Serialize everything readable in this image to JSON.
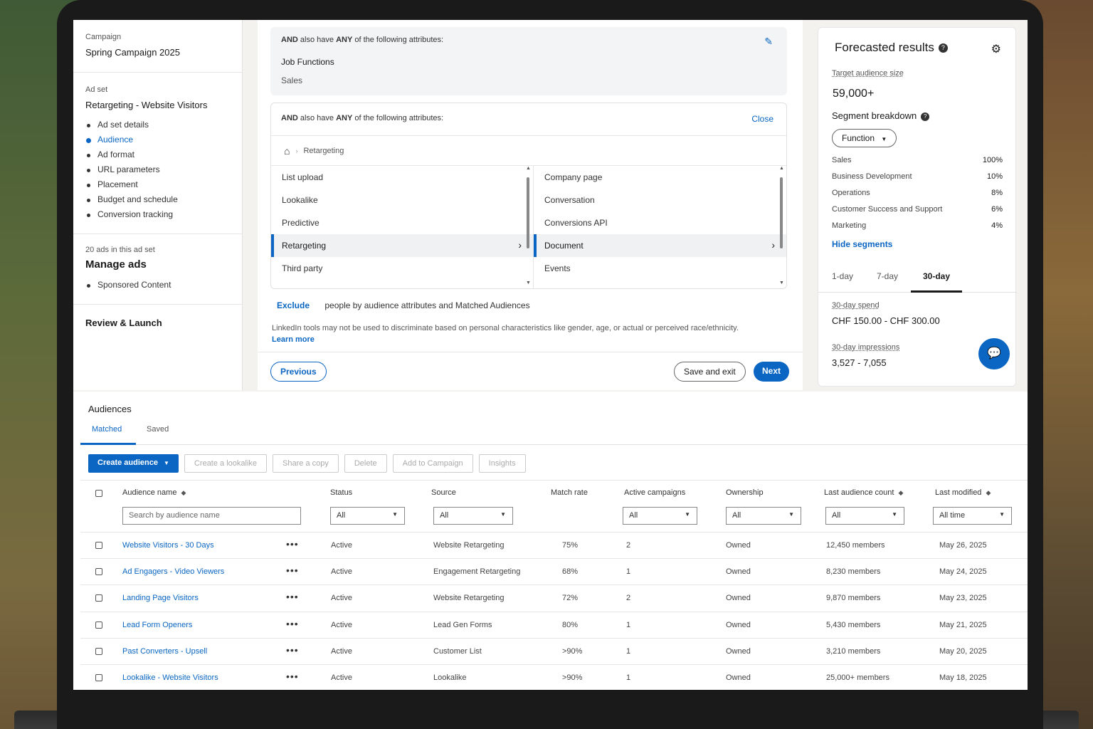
{
  "sidebar": {
    "campaign_label": "Campaign",
    "campaign_name": "Spring Campaign 2025",
    "adset_label": "Ad set",
    "adset_name": "Retargeting - Website Visitors",
    "steps": [
      "Ad set details",
      "Audience",
      "Ad format",
      "URL parameters",
      "Placement",
      "Budget and schedule",
      "Conversion tracking"
    ],
    "active_step": "Audience",
    "ads_count_label": "20 ads in this ad set",
    "manage_ads": "Manage ads",
    "ad_types": [
      "Sponsored Content"
    ],
    "review_launch": "Review & Launch"
  },
  "attributes_card": {
    "and_text": "AND",
    "also_have": "also have",
    "any_text": "ANY",
    "of_following": "of the following attributes:",
    "facet": "Job Functions",
    "facet_value": "Sales"
  },
  "picker": {
    "and_text": "AND",
    "also_have": "also have",
    "any_text": "ANY",
    "of_following": "of the following attributes:",
    "close": "Close",
    "breadcrumb": "Retargeting",
    "left_items": [
      "List upload",
      "Lookalike",
      "Predictive",
      "Retargeting",
      "Third party"
    ],
    "left_selected": 3,
    "right_items": [
      "Company page",
      "Conversation",
      "Conversions API",
      "Document",
      "Events"
    ],
    "right_selected": 3
  },
  "exclude": {
    "link": "Exclude",
    "text": "people by audience attributes and Matched Audiences"
  },
  "disclaimer": {
    "text": "LinkedIn tools may not be used to discriminate based on personal characteristics like gender, age, or actual or perceived race/ethnicity.",
    "learn_more": "Learn more"
  },
  "footer": {
    "previous": "Previous",
    "save_exit": "Save and exit",
    "next": "Next"
  },
  "forecast": {
    "title": "Forecasted results",
    "help_glyph": "?",
    "target_label": "Target audience size",
    "target_value": "59,000+",
    "segment_title": "Segment breakdown",
    "segment_filter": "Function",
    "segments": [
      {
        "name": "Sales",
        "pct": "100%"
      },
      {
        "name": "Business Development",
        "pct": "10%"
      },
      {
        "name": "Operations",
        "pct": "8%"
      },
      {
        "name": "Customer Success and Support",
        "pct": "6%"
      },
      {
        "name": "Marketing",
        "pct": "4%"
      }
    ],
    "hide_segments": "Hide segments",
    "tabs": [
      "1-day",
      "7-day",
      "30-day"
    ],
    "active_tab": "30-day",
    "spend_label": "30-day spend",
    "spend_value": "CHF 150.00 - CHF 300.00",
    "impressions_label": "30-day impressions",
    "impressions_value": "3,527 - 7,055"
  },
  "audiences": {
    "title": "Audiences",
    "tabs": [
      "Matched",
      "Saved"
    ],
    "active_tab": "Matched",
    "toolbar": {
      "create": "Create audience",
      "lookalike": "Create a lookalike",
      "share": "Share a copy",
      "delete": "Delete",
      "add_campaign": "Add to Campaign",
      "insights": "Insights"
    },
    "columns": {
      "name": "Audience name",
      "status": "Status",
      "source": "Source",
      "match": "Match rate",
      "active": "Active campaigns",
      "ownership": "Ownership",
      "count": "Last audience count",
      "modified": "Last modified"
    },
    "filters": {
      "search_placeholder": "Search by audience name",
      "status": "All",
      "source": "All",
      "active": "All",
      "ownership": "All",
      "count": "All",
      "modified": "All time"
    },
    "rows": [
      {
        "name": "Website Visitors - 30 Days",
        "status": "Active",
        "source": "Website Retargeting",
        "match": "75%",
        "active": "2",
        "ownership": "Owned",
        "count": "12,450 members",
        "modified": "May 26, 2025"
      },
      {
        "name": "Ad Engagers - Video Viewers",
        "status": "Active",
        "source": "Engagement Retargeting",
        "match": "68%",
        "active": "1",
        "ownership": "Owned",
        "count": "8,230 members",
        "modified": "May 24, 2025"
      },
      {
        "name": "Landing Page Visitors",
        "status": "Active",
        "source": "Website Retargeting",
        "match": "72%",
        "active": "2",
        "ownership": "Owned",
        "count": "9,870 members",
        "modified": "May 23, 2025"
      },
      {
        "name": "Lead Form Openers",
        "status": "Active",
        "source": "Lead Gen Forms",
        "match": "80%",
        "active": "1",
        "ownership": "Owned",
        "count": "5,430 members",
        "modified": "May 21, 2025"
      },
      {
        "name": "Past Converters - Upsell",
        "status": "Active",
        "source": "Customer List",
        "match": ">90%",
        "active": "1",
        "ownership": "Owned",
        "count": "3,210 members",
        "modified": "May 20, 2025"
      },
      {
        "name": "Lookalike - Website Visitors",
        "status": "Active",
        "source": "Lookalike",
        "match": ">90%",
        "active": "1",
        "ownership": "Owned",
        "count": "25,000+ members",
        "modified": "May 18, 2025"
      }
    ]
  },
  "colors": {
    "accent": "#0a66c2",
    "text": "#191919"
  }
}
